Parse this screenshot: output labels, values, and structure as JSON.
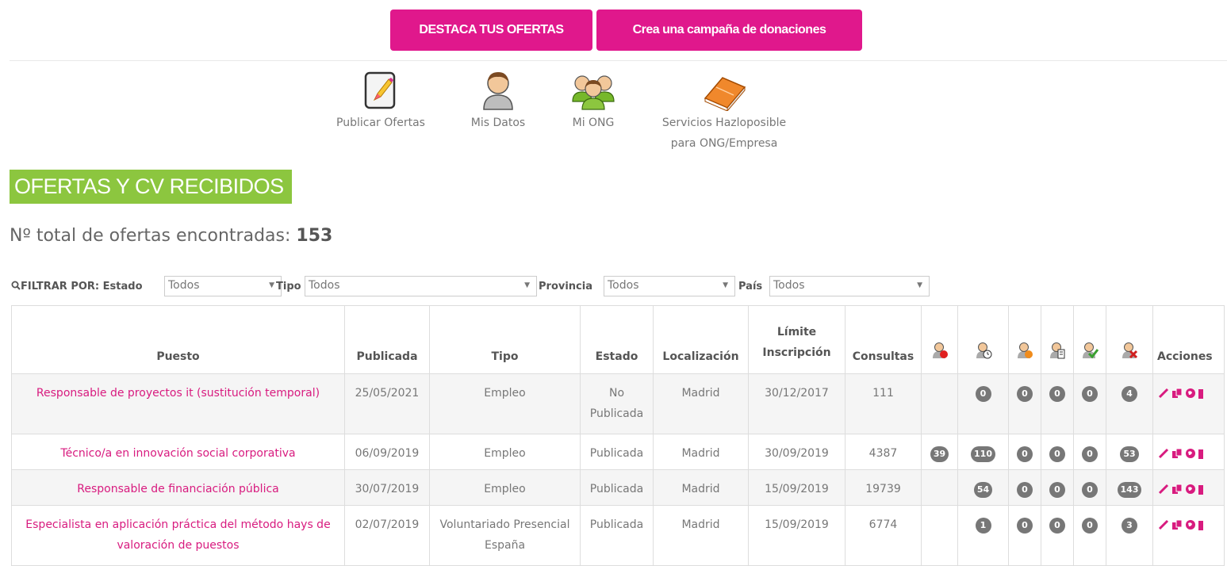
{
  "top_buttons": {
    "highlight": "DESTACA TUS OFERTAS",
    "donations": "Crea una campaña de donaciones"
  },
  "nav": {
    "publish": "Publicar Ofertas",
    "my_data": "Mis Datos",
    "my_ngo": "Mi ONG",
    "services_line1": "Servicios Hazloposible",
    "services_line2": "para ONG/Empresa"
  },
  "section_title": "OFERTAS Y CV RECIBIDOS",
  "total": {
    "label": "Nº total de ofertas encontradas:",
    "value": "153"
  },
  "filter": {
    "label": "FILTRAR POR:",
    "estado_label": "Estado",
    "estado_value": "Todos",
    "tipo_label": "Tipo",
    "tipo_value": "Todos",
    "provincia_label": "Provincia",
    "provincia_value": "Todos",
    "pais_label": "País",
    "pais_value": "Todos"
  },
  "table": {
    "headers": {
      "puesto": "Puesto",
      "publicada": "Publicada",
      "tipo": "Tipo",
      "estado": "Estado",
      "localizacion": "Localización",
      "limite1": "Límite",
      "limite2": "Inscripción",
      "consultas": "Consultas",
      "acciones": "Acciones"
    },
    "rows": [
      {
        "puesto": "Responsable de proyectos it (sustitución temporal)",
        "publicada": "25/05/2021",
        "tipo": "Empleo",
        "estado": "No Publicada",
        "localizacion": "Madrid",
        "limite": "30/12/2017",
        "consultas": "111",
        "c1": "",
        "c2": "0",
        "c3": "0",
        "c4": "0",
        "c5": "0",
        "c6": "4"
      },
      {
        "puesto": "Técnico/a en innovación social corporativa",
        "publicada": "06/09/2019",
        "tipo": "Empleo",
        "estado": "Publicada",
        "localizacion": "Madrid",
        "limite": "30/09/2019",
        "consultas": "4387",
        "c1": "39",
        "c2": "110",
        "c3": "0",
        "c4": "0",
        "c5": "0",
        "c6": "53"
      },
      {
        "puesto": "Responsable de financiación pública",
        "publicada": "30/07/2019",
        "tipo": "Empleo",
        "estado": "Publicada",
        "localizacion": "Madrid",
        "limite": "15/09/2019",
        "consultas": "19739",
        "c1": "",
        "c2": "54",
        "c3": "0",
        "c4": "0",
        "c5": "0",
        "c6": "143"
      },
      {
        "puesto": "Especialista en aplicación práctica del método hays de valoración de puestos",
        "publicada": "02/07/2019",
        "tipo": "Voluntariado Presencial España",
        "estado": "Publicada",
        "localizacion": "Madrid",
        "limite": "15/09/2019",
        "consultas": "6774",
        "c1": "",
        "c2": "1",
        "c3": "0",
        "c4": "0",
        "c5": "0",
        "c6": "3"
      }
    ]
  },
  "colors": {
    "accent": "#e0188c",
    "green": "#8cc63f",
    "link": "#d81b7f",
    "badge": "#777777"
  },
  "icons": [
    "pencil-doc-icon",
    "person-icon",
    "group-icon",
    "book-icon",
    "red-candidate-icon",
    "clock-candidate-icon",
    "orange-candidate-icon",
    "document-candidate-icon",
    "check-candidate-icon",
    "reject-candidate-icon",
    "edit-icon",
    "copy-icon",
    "globe-icon",
    "trash-icon"
  ]
}
